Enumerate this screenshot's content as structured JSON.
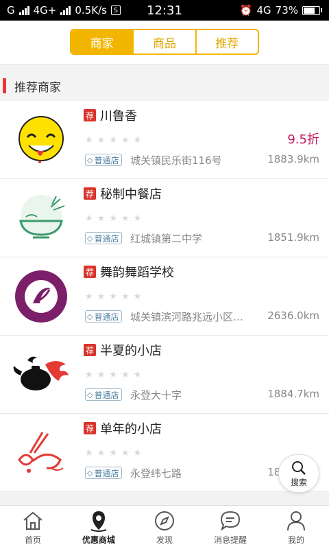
{
  "status": {
    "carrier": "G",
    "network1": "4G+",
    "speed": "0.5K/s",
    "app_icon": "S",
    "time": "12:31",
    "network2": "4G",
    "battery": "73%",
    "battery_level": 0.73
  },
  "tabs": [
    {
      "label": "商家",
      "active": true
    },
    {
      "label": "商品",
      "active": false
    },
    {
      "label": "推荐",
      "active": false
    }
  ],
  "section": {
    "title": "推荐商家"
  },
  "colors": {
    "accent": "#f2b500",
    "tag_red": "#d9342b",
    "discount": "#c2185b"
  },
  "shops": [
    {
      "tag": "荐",
      "name": "川鲁香",
      "discount": "9.5折",
      "badge": "普通店",
      "address": "城关镇民乐街116号",
      "distance": "1883.9km",
      "logo": "smiley-logo"
    },
    {
      "tag": "荐",
      "name": "秘制中餐店",
      "discount": "",
      "badge": "普通店",
      "address": "红城镇第二中学",
      "distance": "1851.9km",
      "logo": "bowl-bamboo-logo"
    },
    {
      "tag": "荐",
      "name": "舞韵舞蹈学校",
      "discount": "",
      "badge": "普通店",
      "address": "城关镇滨河路兆远小区…",
      "distance": "2636.0km",
      "logo": "dance-school-logo"
    },
    {
      "tag": "荐",
      "name": "半夏的小店",
      "discount": "",
      "badge": "普通店",
      "address": "永登大十字",
      "distance": "1884.7km",
      "logo": "teapot-flame-logo"
    },
    {
      "tag": "荐",
      "name": "单年的小店",
      "discount": "",
      "badge": "普通店",
      "address": "永登纬七路",
      "distance": "1883.9km",
      "logo": "chopsticks-logo"
    }
  ],
  "search_fab": {
    "label": "搜索"
  },
  "nav": [
    {
      "label": "首页",
      "icon": "home-icon",
      "active": false
    },
    {
      "label": "优惠商城",
      "icon": "map-pin-icon",
      "active": true
    },
    {
      "label": "发现",
      "icon": "compass-icon",
      "active": false
    },
    {
      "label": "消息提醒",
      "icon": "message-icon",
      "active": false
    },
    {
      "label": "我的",
      "icon": "user-icon",
      "active": false
    }
  ]
}
